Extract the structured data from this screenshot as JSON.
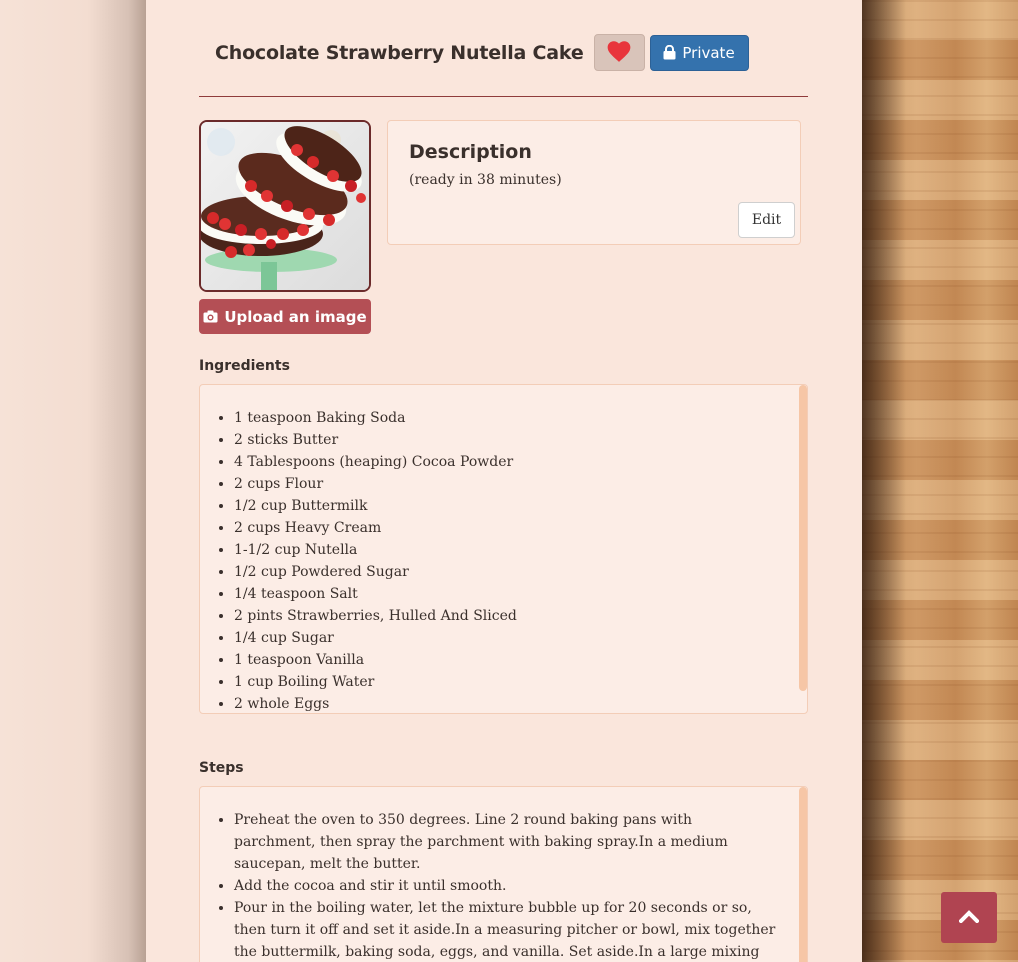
{
  "recipe": {
    "title": "Chocolate Strawberry Nutella Cake",
    "favorite_icon": "heart-icon",
    "private_label": "Private",
    "private_icon": "lock-icon",
    "upload_label": "Upload an image",
    "upload_icon": "camera-icon"
  },
  "description": {
    "heading": "Description",
    "ready_text": "(ready in 38 minutes)",
    "edit_label": "Edit"
  },
  "ingredients": {
    "heading": "Ingredients",
    "items": [
      "1 teaspoon Baking Soda",
      "2 sticks Butter",
      "4 Tablespoons (heaping) Cocoa Powder",
      "2 cups Flour",
      "1/2 cup Buttermilk",
      "2 cups Heavy Cream",
      "1-1/2 cup Nutella",
      "1/2 cup Powdered Sugar",
      "1/4 teaspoon Salt",
      "2 pints Strawberries, Hulled And Sliced",
      "1/4 cup Sugar",
      "1 teaspoon Vanilla",
      "1 cup Boiling Water",
      "2 whole Eggs"
    ]
  },
  "steps": {
    "heading": "Steps",
    "items": [
      "Preheat the oven to 350 degrees. Line 2 round baking pans with parchment, then spray the parchment with baking spray.In a medium saucepan, melt the butter.",
      "Add the cocoa and stir it until smooth.",
      "Pour in the boiling water, let the mixture bubble up for 20 seconds or so, then turn it off and set it aside.In a measuring pitcher or bowl, mix together the buttermilk, baking soda, eggs, and vanilla. Set aside.In a large mixing"
    ]
  },
  "scroll_top_icon": "chevron-up-icon",
  "colors": {
    "accent_blue": "#3472ad",
    "upload_red": "#b44f55",
    "heart_red": "#e8353c",
    "page_bg": "#fae6dc"
  }
}
